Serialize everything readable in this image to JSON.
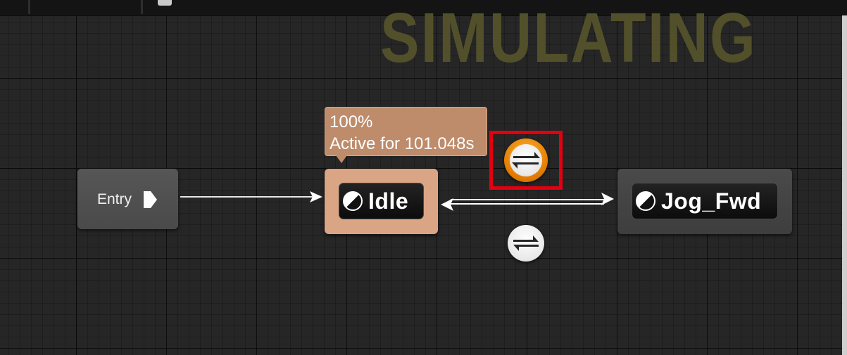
{
  "graph": {
    "mode_watermark": "SIMULATING"
  },
  "nodes": {
    "entry": {
      "label": "Entry"
    },
    "idle": {
      "label": "Idle",
      "status": "active"
    },
    "jog_fwd": {
      "label": "Jog_Fwd"
    }
  },
  "tooltip": {
    "line1": "100%",
    "line2": "Active for 101.048s"
  },
  "transitions": [
    {
      "from": "Idle",
      "to": "Jog_Fwd",
      "icon": "swap-arrows-icon",
      "state": "active"
    },
    {
      "from": "Jog_Fwd",
      "to": "Idle",
      "icon": "swap-arrows-icon",
      "state": "inactive"
    }
  ],
  "colors": {
    "active_node": "#d9a585",
    "active_transition": "#e98c00",
    "highlight": "#e3000f",
    "watermark": "#52502a"
  }
}
